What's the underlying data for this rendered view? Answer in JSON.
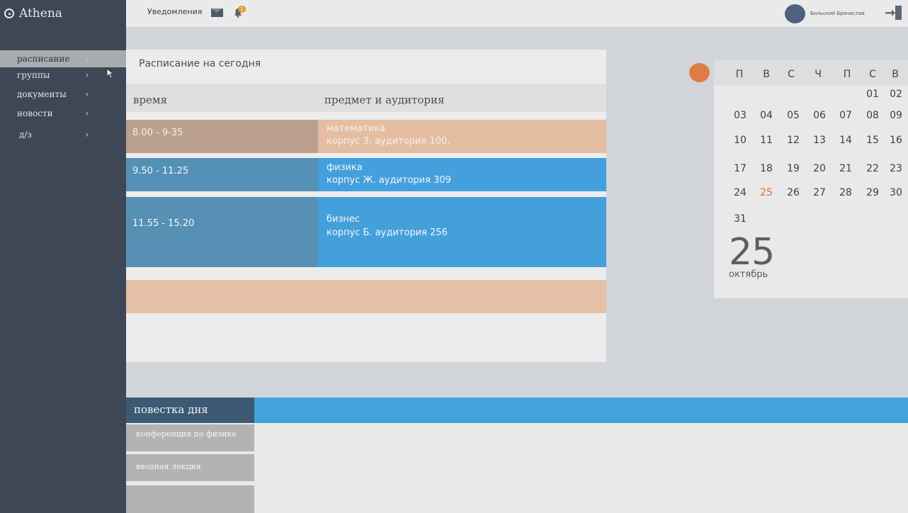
{
  "app": {
    "name": "Athena"
  },
  "sidebar": {
    "items": [
      {
        "label": "расписание",
        "active": true
      },
      {
        "label": "группы",
        "active": false
      },
      {
        "label": "документы",
        "active": false
      },
      {
        "label": "новости",
        "active": false
      },
      {
        "label": "д/з",
        "active": false
      }
    ],
    "chevron": "›"
  },
  "topbar": {
    "notifications_label": "Уведомления",
    "bell_badge": "1",
    "user_name": "Бильский Бронислав",
    "icons": [
      "mail-icon",
      "bell-icon",
      "logout-icon"
    ]
  },
  "schedule": {
    "title": "Расписание на сегодня",
    "col_time": "время",
    "col_subject": "предмет и аудитория",
    "rows": [
      {
        "time": "8.00 - 9-35",
        "subject": "математика",
        "room": "корпус З. аудитория 100.",
        "time_color": "#bba08f",
        "subject_color": "#e5bda3",
        "text_color": "#f6efe9"
      },
      {
        "time": "9.50 - 11.25",
        "subject": "физика",
        "room": "корпус Ж. аудитория 309",
        "time_color": "#5590b6",
        "subject_color": "#43a0dc",
        "text_color": "#f1f7fb"
      },
      {
        "time": "11.55 - 15.20",
        "subject": "бизнес",
        "room": "корпус Б. аудитория 256",
        "time_color": "#5690b5",
        "subject_color": "#44a0db",
        "text_color": "#f1f7fb"
      }
    ]
  },
  "calendar": {
    "weekdays": [
      "П",
      "В",
      "С",
      "Ч",
      "П",
      "С",
      "В"
    ],
    "weeks": [
      [
        "",
        "",
        "",
        "",
        "",
        "01",
        "02"
      ],
      [
        "03",
        "04",
        "05",
        "06",
        "07",
        "08",
        "09"
      ],
      [
        "10",
        "11",
        "12",
        "13",
        "14",
        "15",
        "16"
      ],
      [
        "17",
        "18",
        "19",
        "20",
        "21",
        "22",
        "23"
      ],
      [
        "24",
        "25",
        "26",
        "27",
        "28",
        "29",
        "30"
      ],
      [
        "31",
        "",
        "",
        "",
        "",
        "",
        ""
      ]
    ],
    "today": "25",
    "big_day": "25",
    "big_month": "октябрь",
    "accent_color": "#e07b45"
  },
  "agenda": {
    "title": "повестка дня",
    "items": [
      {
        "label": "конференция по физике"
      },
      {
        "label": "вводная лекция"
      },
      {
        "label": ""
      }
    ]
  }
}
